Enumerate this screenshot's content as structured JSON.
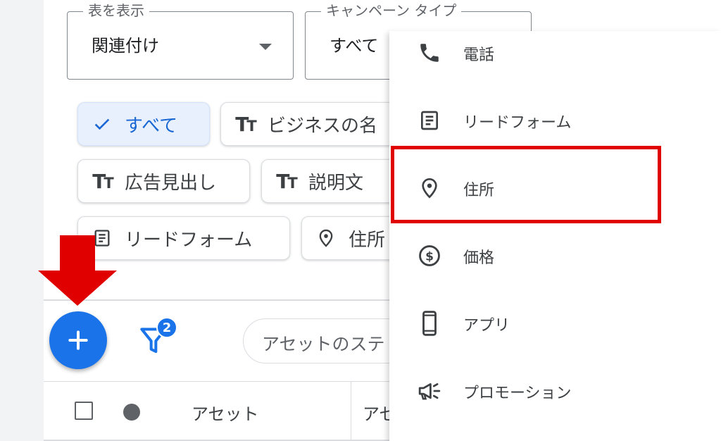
{
  "filters": {
    "view": {
      "legend": "表を表示",
      "value": "関連付け"
    },
    "campaign_type": {
      "legend": "キャンペーン タイプ",
      "value": "すべて"
    }
  },
  "chips": [
    {
      "label": "すべて",
      "icon": "check-icon",
      "selected": true
    },
    {
      "label": "ビジネスの名",
      "icon": "text-tt-icon"
    },
    {
      "label": "広告見出し",
      "icon": "text-tt-icon"
    },
    {
      "label": "説明文",
      "icon": "text-tt-icon"
    },
    {
      "label": "リードフォーム",
      "icon": "form-icon"
    },
    {
      "label": "住所",
      "icon": "location-pin-icon"
    }
  ],
  "toolbar": {
    "filter_badge": "2",
    "search_placeholder": "アセットのステ"
  },
  "table": {
    "headers": [
      "アセット",
      "アセ"
    ]
  },
  "menu": {
    "items": [
      {
        "label": "電話",
        "icon": "phone-icon"
      },
      {
        "label": "リードフォーム",
        "icon": "form-icon"
      },
      {
        "label": "住所",
        "icon": "location-pin-icon",
        "highlighted": true
      },
      {
        "label": "価格",
        "icon": "price-dollar-icon"
      },
      {
        "label": "アプリ",
        "icon": "mobile-phone-icon"
      },
      {
        "label": "プロモーション",
        "icon": "megaphone-icon"
      }
    ]
  },
  "colors": {
    "accent": "#1a73e8",
    "chip_selected_bg": "#e8f0fe",
    "highlight_border": "#e00000",
    "annotation_arrow": "#e00000"
  }
}
